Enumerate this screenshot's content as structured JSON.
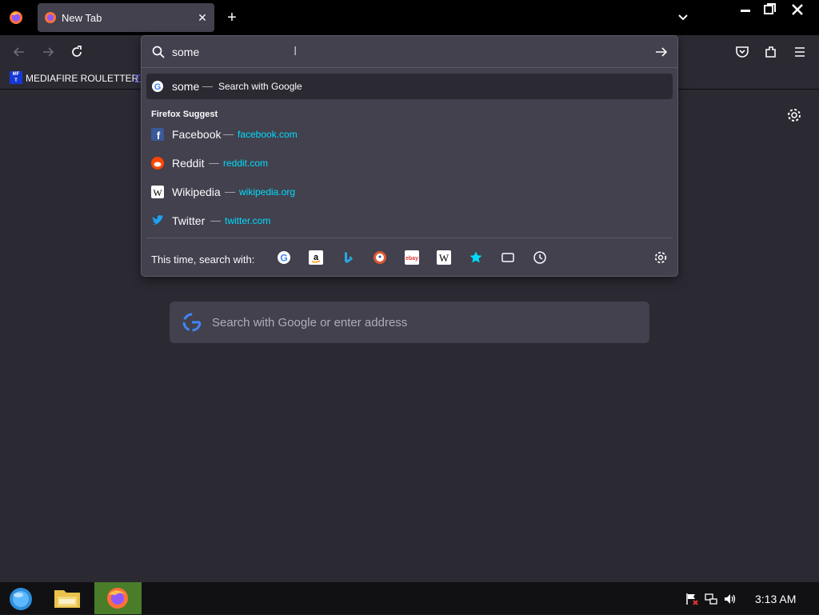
{
  "tabs": [
    {
      "title": "New Tab"
    }
  ],
  "bookmarks_bar": {
    "items": [
      {
        "label": "MEDIAFIRE ROULETTER",
        "icon": "mediafire-icon"
      }
    ]
  },
  "urlbar": {
    "input_value": "some",
    "heuristic": {
      "title": "some",
      "action": "Search with Google",
      "icon": "google-icon"
    },
    "group_label": "Firefox Suggest",
    "suggestions": [
      {
        "title": "Facebook",
        "url": "facebook.com",
        "icon": "facebook-icon"
      },
      {
        "title": "Reddit",
        "url": "reddit.com",
        "icon": "reddit-icon"
      },
      {
        "title": "Wikipedia",
        "url": "wikipedia.org",
        "icon": "wikipedia-icon"
      },
      {
        "title": "Twitter",
        "url": "twitter.com",
        "icon": "twitter-icon"
      }
    ],
    "one_off_label": "This time, search with:",
    "one_off_engines": [
      "google-icon",
      "amazon-icon",
      "bing-icon",
      "duckduckgo-icon",
      "ebay-icon",
      "wikipedia-icon",
      "bookmarks-star-icon",
      "tabs-icon",
      "history-icon"
    ],
    "separator": "—"
  },
  "newtab": {
    "search_placeholder": "Search with Google or enter address"
  },
  "taskbar": {
    "clock": "3:13 AM"
  },
  "colors": {
    "accent_url": "#00ddff",
    "panel_bg": "#42414d",
    "page_bg": "#2b2a33",
    "taskbar_firefox_highlight": "#4a7d29"
  }
}
